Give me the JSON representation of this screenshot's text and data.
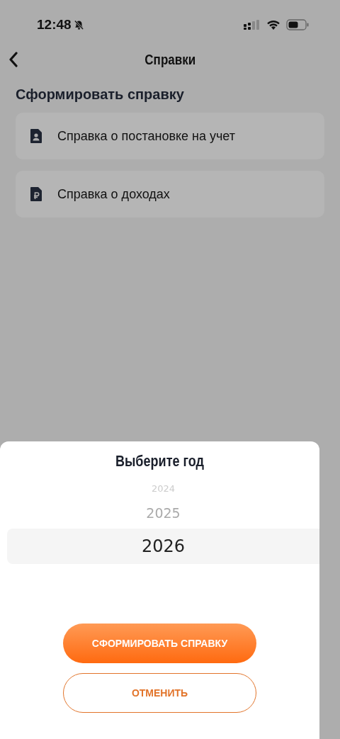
{
  "status_bar": {
    "time": "12:48",
    "silent": true
  },
  "nav": {
    "title": "Справки"
  },
  "section": {
    "title": "Сформировать справку",
    "items": [
      {
        "kind": "person",
        "label": "Справка о постановке на учет"
      },
      {
        "kind": "ruble",
        "label": "Справка о доходах"
      }
    ]
  },
  "sheet": {
    "title": "Выберите год",
    "years": [
      {
        "label": "2024",
        "selected": false
      },
      {
        "label": "2025",
        "selected": false
      },
      {
        "label": "2026",
        "selected": true
      }
    ],
    "buttons": [
      {
        "kind": "primary",
        "label": "СФОРМИРОВАТЬ СПРАВКУ"
      },
      {
        "kind": "secondary",
        "label": "ОТМЕНИТЬ"
      }
    ]
  }
}
